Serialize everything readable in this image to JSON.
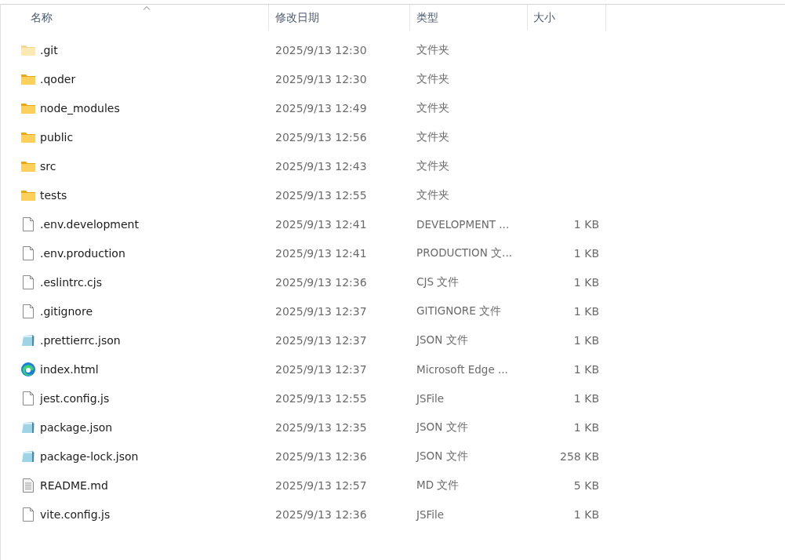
{
  "columns": [
    {
      "label": "名称",
      "sorted": true
    },
    {
      "label": "修改日期",
      "sorted": false
    },
    {
      "label": "类型",
      "sorted": false
    },
    {
      "label": "大小",
      "sorted": false
    }
  ],
  "rows": [
    {
      "kind": "folder",
      "hidden": true,
      "name": ".git",
      "modified": "2025/9/13 12:30",
      "type": "文件夹"
    },
    {
      "kind": "folder",
      "hidden": false,
      "name": ".qoder",
      "modified": "2025/9/13 12:30",
      "type": "文件夹"
    },
    {
      "kind": "folder",
      "hidden": false,
      "name": "node_modules",
      "modified": "2025/9/13 12:49",
      "type": "文件夹"
    },
    {
      "kind": "folder",
      "hidden": false,
      "name": "public",
      "modified": "2025/9/13 12:56",
      "type": "文件夹"
    },
    {
      "kind": "folder",
      "hidden": false,
      "name": "src",
      "modified": "2025/9/13 12:43",
      "type": "文件夹"
    },
    {
      "kind": "folder",
      "hidden": false,
      "name": "tests",
      "modified": "2025/9/13 12:55",
      "type": "文件夹"
    },
    {
      "kind": "file",
      "hidden": false,
      "name": ".env.development",
      "modified": "2025/9/13 12:41",
      "type": "DEVELOPMENT ...",
      "size": "1 KB"
    },
    {
      "kind": "file",
      "hidden": false,
      "name": ".env.production",
      "modified": "2025/9/13 12:41",
      "type": "PRODUCTION 文...",
      "size": "1 KB"
    },
    {
      "kind": "file",
      "hidden": false,
      "name": ".eslintrc.cjs",
      "modified": "2025/9/13 12:36",
      "type": "CJS 文件",
      "size": "1 KB"
    },
    {
      "kind": "file",
      "hidden": false,
      "name": ".gitignore",
      "modified": "2025/9/13 12:37",
      "type": "GITIGNORE 文件",
      "size": "1 KB"
    },
    {
      "kind": "json",
      "hidden": false,
      "name": ".prettierrc.json",
      "modified": "2025/9/13 12:37",
      "type": "JSON 文件",
      "size": "1 KB"
    },
    {
      "kind": "browser",
      "hidden": false,
      "name": "index.html",
      "modified": "2025/9/13 12:37",
      "type": "Microsoft Edge ...",
      "size": "1 KB"
    },
    {
      "kind": "file",
      "hidden": false,
      "name": "jest.config.js",
      "modified": "2025/9/13 12:55",
      "type": "JSFile",
      "size": "1 KB"
    },
    {
      "kind": "json",
      "hidden": false,
      "name": "package.json",
      "modified": "2025/9/13 12:35",
      "type": "JSON 文件",
      "size": "1 KB"
    },
    {
      "kind": "json",
      "hidden": false,
      "name": "package-lock.json",
      "modified": "2025/9/13 12:36",
      "type": "JSON 文件",
      "size": "258 KB"
    },
    {
      "kind": "text",
      "hidden": false,
      "name": "README.md",
      "modified": "2025/9/13 12:57",
      "type": "MD 文件",
      "size": "5 KB"
    },
    {
      "kind": "file",
      "hidden": false,
      "name": "vite.config.js",
      "modified": "2025/9/13 12:36",
      "type": "JSFile",
      "size": "1 KB"
    }
  ]
}
